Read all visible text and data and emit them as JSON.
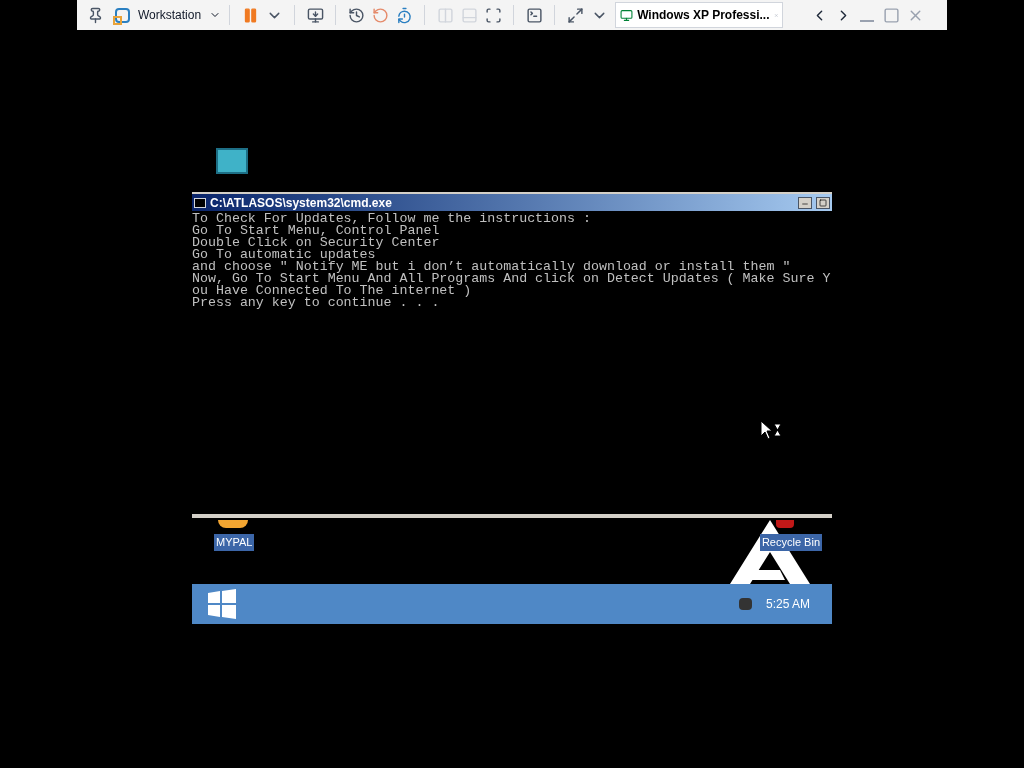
{
  "toolbar": {
    "product": "Workstation",
    "tab": {
      "title": "Windows XP Professi...",
      "selected": true
    }
  },
  "cmd_window": {
    "title": "C:\\ATLASOS\\system32\\cmd.exe",
    "lines": [
      "To Check For Updates, Follow me the instructions :",
      "Go To Start Menu, Control Panel",
      "Double Click on Security Center",
      "Go To automatic updates",
      "and choose \" Notify ME but i don’t automatically download or install them \"",
      "Now, Go To Start Menu And All Programs And click on Detect Updates ( Make Sure Y",
      "ou Have Connected To The internet )",
      "Press any key to continue . . ."
    ]
  },
  "desktop_icons": [
    {
      "label": "MYPAL"
    },
    {
      "label": "Recycle Bin"
    }
  ],
  "taskbar": {
    "clock": "5:25 AM"
  }
}
